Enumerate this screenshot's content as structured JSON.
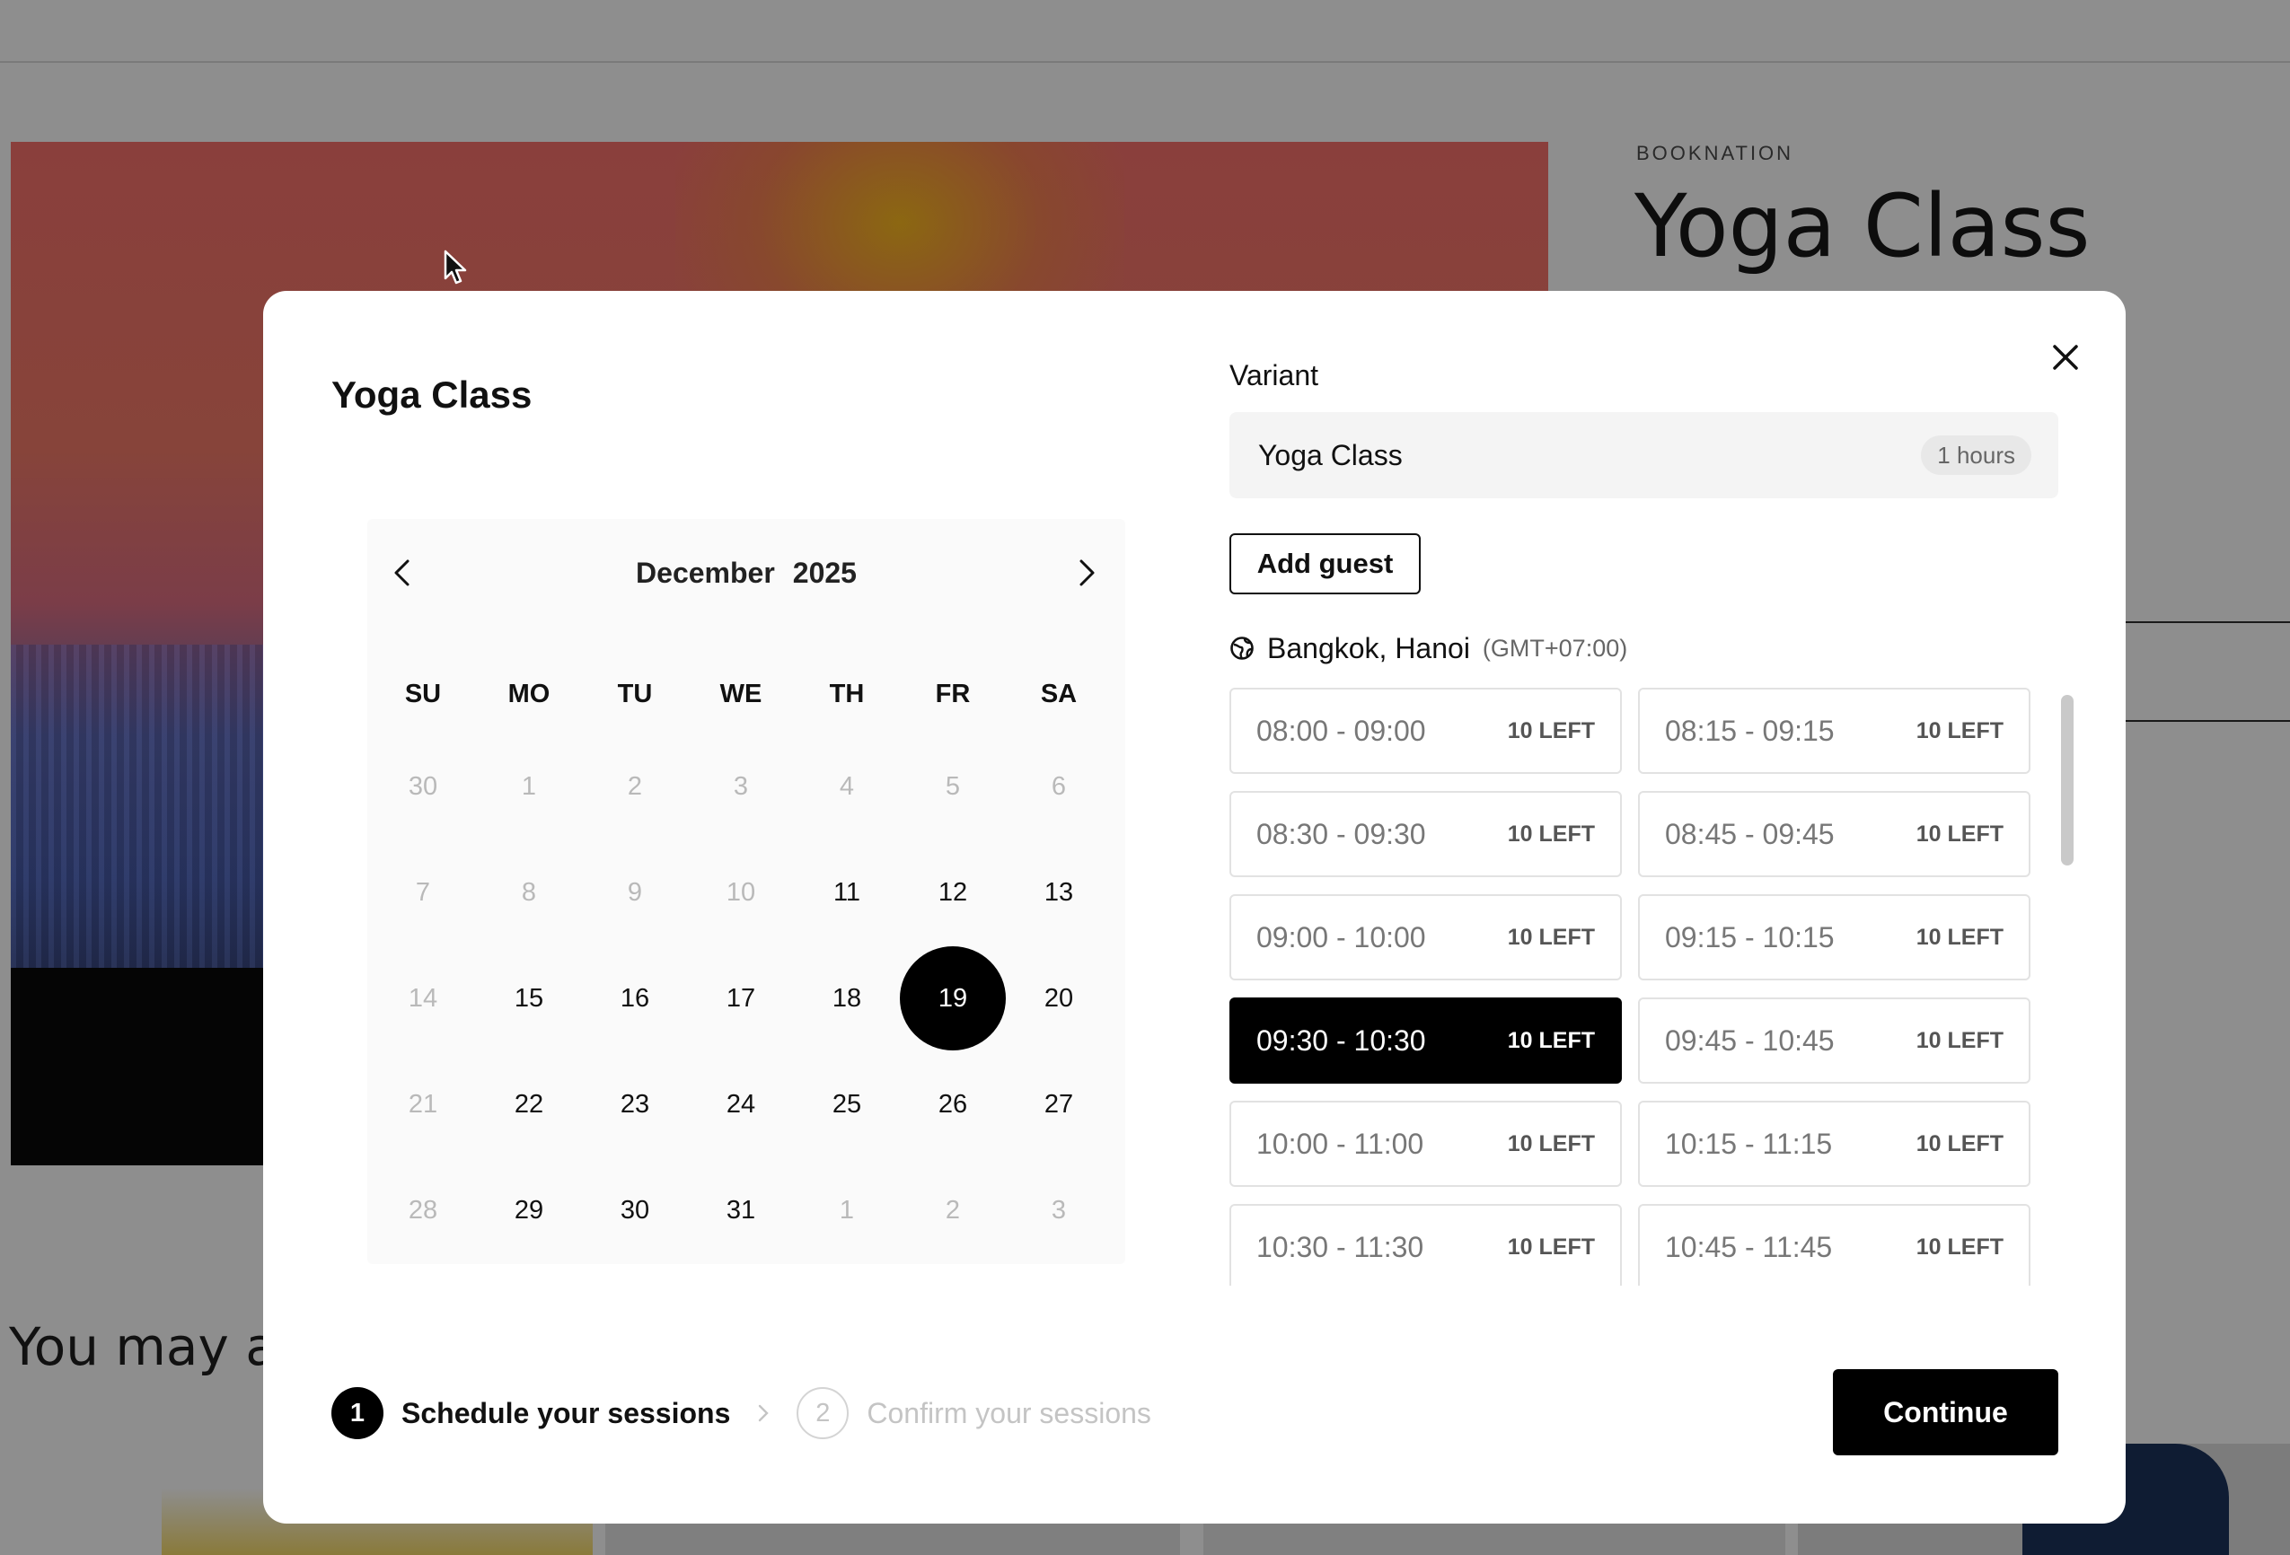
{
  "background": {
    "vendor": "BOOKNATION",
    "product_title": "Yoga Class",
    "section_title": "You may als"
  },
  "modal": {
    "title": "Yoga Class",
    "close_icon": "close-icon",
    "calendar": {
      "month": "December",
      "year": "2025",
      "prev_icon": "chevron-left-icon",
      "next_icon": "chevron-right-icon",
      "weekdays": [
        "SU",
        "MO",
        "TU",
        "WE",
        "TH",
        "FR",
        "SA"
      ],
      "weeks": [
        [
          {
            "d": "30",
            "m": true
          },
          {
            "d": "1",
            "m": true
          },
          {
            "d": "2",
            "m": true
          },
          {
            "d": "3",
            "m": true
          },
          {
            "d": "4",
            "m": true
          },
          {
            "d": "5",
            "m": true
          },
          {
            "d": "6",
            "m": true
          }
        ],
        [
          {
            "d": "7",
            "m": true
          },
          {
            "d": "8",
            "m": true
          },
          {
            "d": "9",
            "m": true
          },
          {
            "d": "10",
            "m": true
          },
          {
            "d": "11",
            "m": false
          },
          {
            "d": "12",
            "m": false
          },
          {
            "d": "13",
            "m": false
          }
        ],
        [
          {
            "d": "14",
            "m": true
          },
          {
            "d": "15",
            "m": false
          },
          {
            "d": "16",
            "m": false
          },
          {
            "d": "17",
            "m": false
          },
          {
            "d": "18",
            "m": false
          },
          {
            "d": "19",
            "m": false,
            "s": true
          },
          {
            "d": "20",
            "m": false
          }
        ],
        [
          {
            "d": "21",
            "m": true
          },
          {
            "d": "22",
            "m": false
          },
          {
            "d": "23",
            "m": false
          },
          {
            "d": "24",
            "m": false
          },
          {
            "d": "25",
            "m": false
          },
          {
            "d": "26",
            "m": false
          },
          {
            "d": "27",
            "m": false
          }
        ],
        [
          {
            "d": "28",
            "m": true
          },
          {
            "d": "29",
            "m": false
          },
          {
            "d": "30",
            "m": false
          },
          {
            "d": "31",
            "m": false
          },
          {
            "d": "1",
            "m": true
          },
          {
            "d": "2",
            "m": true
          },
          {
            "d": "3",
            "m": true
          }
        ]
      ],
      "selected_day": "19"
    },
    "variant": {
      "label": "Variant",
      "selected": "Yoga Class",
      "duration": "1 hours"
    },
    "add_guest_label": "Add guest",
    "timezone": {
      "icon": "globe-icon",
      "city": "Bangkok, Hanoi",
      "offset": "(GMT+07:00)"
    },
    "slots": [
      {
        "time": "08:00 - 09:00",
        "left": "10 LEFT",
        "active": false
      },
      {
        "time": "08:15 - 09:15",
        "left": "10 LEFT",
        "active": false
      },
      {
        "time": "08:30 - 09:30",
        "left": "10 LEFT",
        "active": false
      },
      {
        "time": "08:45 - 09:45",
        "left": "10 LEFT",
        "active": false
      },
      {
        "time": "09:00 - 10:00",
        "left": "10 LEFT",
        "active": false
      },
      {
        "time": "09:15 - 10:15",
        "left": "10 LEFT",
        "active": false
      },
      {
        "time": "09:30 - 10:30",
        "left": "10 LEFT",
        "active": true
      },
      {
        "time": "09:45 - 10:45",
        "left": "10 LEFT",
        "active": false
      },
      {
        "time": "10:00 - 11:00",
        "left": "10 LEFT",
        "active": false
      },
      {
        "time": "10:15 - 11:15",
        "left": "10 LEFT",
        "active": false
      },
      {
        "time": "10:30 - 11:30",
        "left": "10 LEFT",
        "active": false
      },
      {
        "time": "10:45 - 11:45",
        "left": "10 LEFT",
        "active": false
      }
    ],
    "steps": [
      {
        "number": "1",
        "label": "Schedule your sessions",
        "active": true
      },
      {
        "number": "2",
        "label": "Confirm your sessions",
        "active": false
      }
    ],
    "step_separator_icon": "chevron-right-icon",
    "continue_label": "Continue"
  },
  "colors": {
    "accent": "#000000",
    "overlay": "#8e8e8e",
    "muted_text": "#b9b9b9"
  }
}
